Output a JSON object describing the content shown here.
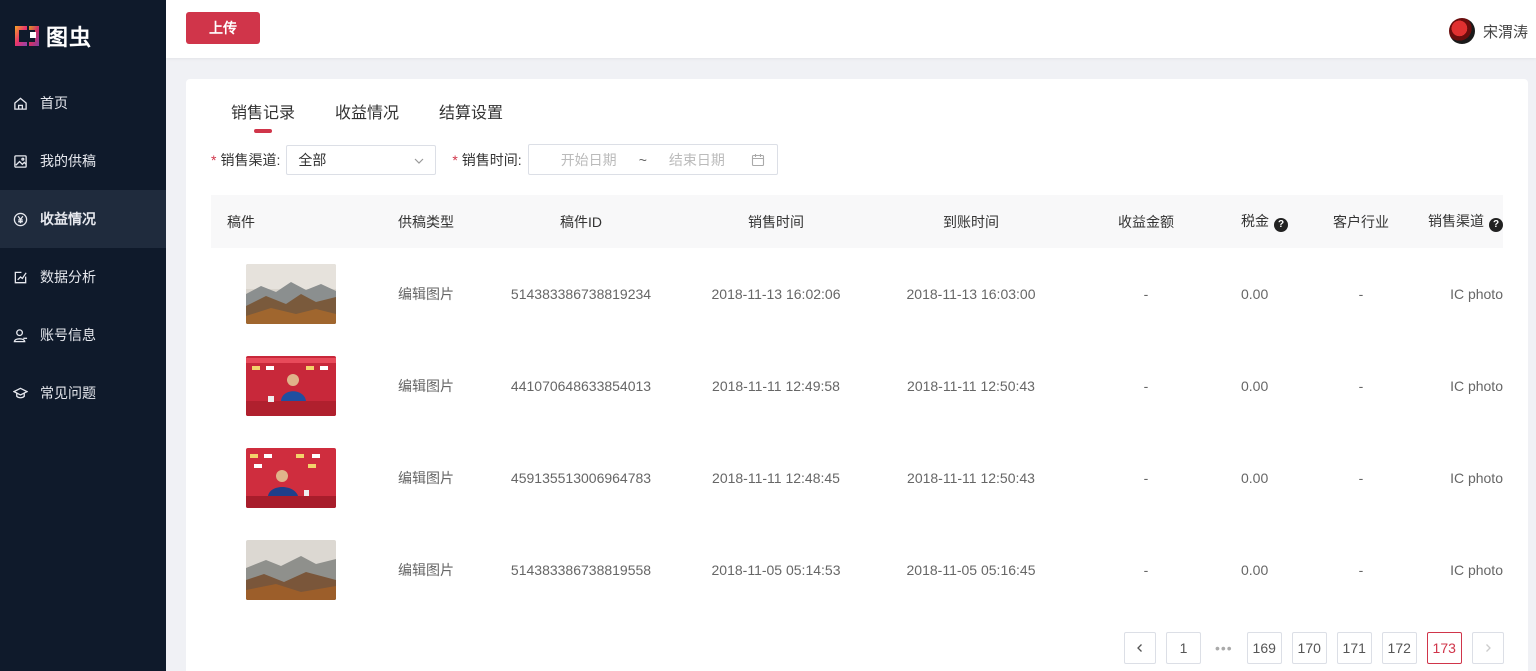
{
  "app": {
    "logo_text": "图虫",
    "brand_color": "#d0354a"
  },
  "sidebar": {
    "items": [
      {
        "label": "首页",
        "icon": "home-icon",
        "active": false
      },
      {
        "label": "我的供稿",
        "icon": "image-icon",
        "active": false
      },
      {
        "label": "收益情况",
        "icon": "yen-icon",
        "active": true
      },
      {
        "label": "数据分析",
        "icon": "chart-edit-icon",
        "active": false
      },
      {
        "label": "账号信息",
        "icon": "user-icon",
        "active": false
      },
      {
        "label": "常见问题",
        "icon": "graduation-cap-icon",
        "active": false
      }
    ]
  },
  "header": {
    "upload_label": "上传",
    "username": "宋渭涛"
  },
  "tabs": [
    {
      "label": "销售记录",
      "active": true
    },
    {
      "label": "收益情况",
      "active": false
    },
    {
      "label": "结算设置",
      "active": false
    }
  ],
  "filters": {
    "required_mark": "*",
    "channel_label": "销售渠道:",
    "channel_value": "全部",
    "time_label": "销售时间:",
    "start_placeholder": "开始日期",
    "range_sep": "~",
    "end_placeholder": "结束日期"
  },
  "table": {
    "headers": [
      "稿件",
      "供稿类型",
      "稿件ID",
      "销售时间",
      "到账时间",
      "收益金额",
      "税金",
      "客户行业",
      "销售渠道"
    ],
    "help_glyph": "?",
    "rows": [
      {
        "thumb": "mountain-photo",
        "type": "编辑图片",
        "id": "514383386738819234",
        "sale_time": "2018-11-13 16:02:06",
        "arrival_time": "2018-11-13 16:03:00",
        "income": "-",
        "tax": "0.00",
        "industry": "-",
        "channel": "IC photo"
      },
      {
        "thumb": "press-conference-photo",
        "type": "编辑图片",
        "id": "441070648633854013",
        "sale_time": "2018-11-11 12:49:58",
        "arrival_time": "2018-11-11 12:50:43",
        "income": "-",
        "tax": "0.00",
        "industry": "-",
        "channel": "IC photo"
      },
      {
        "thumb": "press-conference-photo",
        "type": "编辑图片",
        "id": "459135513006964783",
        "sale_time": "2018-11-11 12:48:45",
        "arrival_time": "2018-11-11 12:50:43",
        "income": "-",
        "tax": "0.00",
        "industry": "-",
        "channel": "IC photo"
      },
      {
        "thumb": "mountain-photo",
        "type": "编辑图片",
        "id": "514383386738819558",
        "sale_time": "2018-11-05 05:14:53",
        "arrival_time": "2018-11-05 05:16:45",
        "income": "-",
        "tax": "0.00",
        "industry": "-",
        "channel": "IC photo"
      }
    ]
  },
  "pagination": {
    "first": "1",
    "ellipsis": "•••",
    "pages": [
      "169",
      "170",
      "171",
      "172",
      "173"
    ],
    "current": "173"
  }
}
